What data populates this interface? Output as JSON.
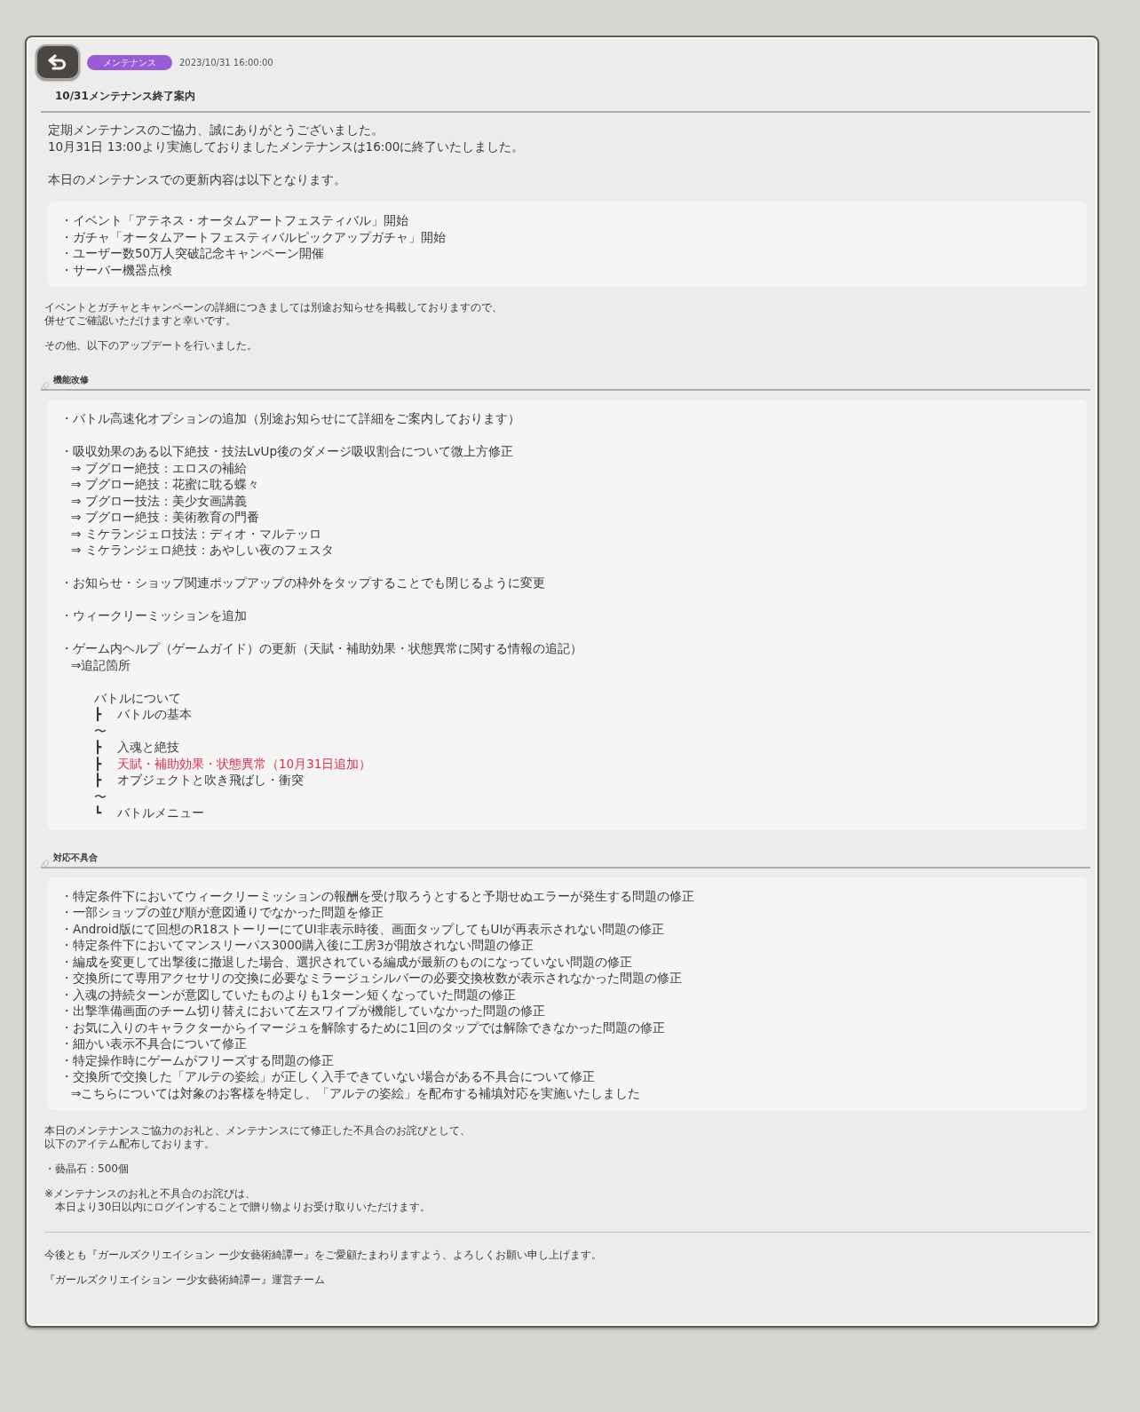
{
  "header": {
    "category": "メンテナンス",
    "date": "2023/10/31 16:00:00",
    "title": "10/31メンテナンス終了案内"
  },
  "blocks": [
    {
      "kind": "text",
      "paragraphs": [
        [
          "定期メンテナンスのご協力、誠にありがとうございました。",
          "10月31日 13:00より実施しておりましたメンテナンスは16:00に終了いたしました。"
        ],
        [
          "本日のメンテナンスでの更新内容は以下となります。"
        ]
      ]
    },
    {
      "kind": "box",
      "groups": [
        {
          "kind": "list",
          "items": [
            {
              "text": "・イベント「アテネス・オータムアートフェスティバル」開始"
            },
            {
              "text": "・ガチャ「オータムアートフェスティバルピックアップガチャ」開始"
            },
            {
              "text": "・ユーザー数50万人突破記念キャンペーン開催"
            },
            {
              "text": "・サーバー機器点検"
            }
          ]
        }
      ]
    },
    {
      "kind": "note",
      "paragraphs": [
        [
          "イベントとガチャとキャンペーンの詳細につきましては別途お知らせを掲載しておりますので、",
          "併せてご確認いただけますと幸いです。"
        ],
        [
          "その他、以下のアップデートを行いました。"
        ]
      ]
    },
    {
      "kind": "section",
      "title": "機能改修"
    },
    {
      "kind": "box",
      "groups": [
        {
          "kind": "list",
          "items": [
            {
              "text": "・バトル高速化オプションの追加（別途お知らせにて詳細をご案内しております）"
            }
          ]
        },
        {
          "kind": "list",
          "items": [
            {
              "text": "・吸収効果のある以下絶技・技法LvUp後のダメージ吸収割合について微上方修正",
              "children": [
                {
                  "text": "⇒ ブグロー絶技：エロスの補給"
                },
                {
                  "text": "⇒ ブグロー絶技：花蜜に耽る蝶々"
                },
                {
                  "text": "⇒ ブグロー技法：美少女画講義"
                },
                {
                  "text": "⇒ ブグロー絶技：美術教育の門番"
                },
                {
                  "text": "⇒ ミケランジェロ技法：ディオ・マルテッロ"
                },
                {
                  "text": "⇒ ミケランジェロ絶技：あやしい夜のフェスタ"
                }
              ]
            }
          ]
        },
        {
          "kind": "list",
          "items": [
            {
              "text": "・お知らせ・ショップ関連ポップアップの枠外をタップすることでも閉じるように変更"
            }
          ]
        },
        {
          "kind": "list",
          "items": [
            {
              "text": "・ウィークリーミッションを追加"
            }
          ]
        },
        {
          "kind": "list",
          "items": [
            {
              "text": "・ゲーム内ヘルプ（ゲームガイド）の更新（天賦・補助効果・状態異常に関する情報の追記）",
              "children": [
                {
                  "text": "⇒追記箇所"
                }
              ]
            }
          ]
        },
        {
          "kind": "tree",
          "title": "バトルについて",
          "rows": [
            {
              "mark": "┣",
              "text": "バトルの基本",
              "highlight": false
            },
            {
              "mark": "〜"
            },
            {
              "mark": "┣",
              "text": "入魂と絶技",
              "highlight": false
            },
            {
              "mark": "┣",
              "text": "天賦・補助効果・状態異常（10月31日追加）",
              "highlight": true
            },
            {
              "mark": "┣",
              "text": "オブジェクトと吹き飛ばし・衝突",
              "highlight": false
            },
            {
              "mark": "〜"
            },
            {
              "mark": "┗",
              "text": "バトルメニュー",
              "highlight": false
            }
          ]
        }
      ]
    },
    {
      "kind": "section",
      "title": "対応不具合"
    },
    {
      "kind": "box",
      "groups": [
        {
          "kind": "list",
          "items": [
            {
              "text": "・特定条件下においてウィークリーミッションの報酬を受け取ろうとすると予期せぬエラーが発生する問題の修正"
            },
            {
              "text": "・一部ショップの並び順が意図通りでなかった問題を修正"
            },
            {
              "text": "・Android版にて回想のR18ストーリーにてUI非表示時後、画面タップしてもUIが再表示されない問題の修正"
            },
            {
              "text": "・特定条件下においてマンスリーパス3000購入後に工房3が開放されない問題の修正"
            },
            {
              "text": "・編成を変更して出撃後に撤退した場合、選択されている編成が最新のものになっていない問題の修正"
            },
            {
              "text": "・交換所にて専用アクセサリの交換に必要なミラージュシルバーの必要交換枚数が表示されなかった問題の修正"
            },
            {
              "text": "・入魂の持続ターンが意図していたものよりも1ターン短くなっていた問題の修正"
            },
            {
              "text": "・出撃準備画面のチーム切り替えにおいて左スワイプが機能していなかった問題の修正"
            },
            {
              "text": "・お気に入りのキャラクターからイマージュを解除するために1回のタップでは解除できなかった問題の修正"
            },
            {
              "text": "・細かい表示不具合について修正"
            },
            {
              "text": "・特定操作時にゲームがフリーズする問題の修正"
            },
            {
              "text": "・交換所で交換した「アルテの姿絵」が正しく入手できていない場合がある不具合について修正",
              "children": [
                {
                  "text": "⇒こちらについては対象のお客様を特定し、「アルテの姿絵」を配布する補填対応を実施いたしました"
                }
              ]
            }
          ]
        }
      ]
    },
    {
      "kind": "note",
      "paragraphs": [
        [
          "本日のメンテナンスご協力のお礼と、メンテナンスにて修正した不具合のお詫びとして、",
          "以下のアイテム配布しております。"
        ],
        [
          "・藝晶石：500個"
        ],
        [
          "※メンテナンスのお礼と不具合のお詫びは、",
          "　本日より30日以内にログインすることで贈り物よりお受け取りいただけます。"
        ]
      ]
    },
    {
      "kind": "divider"
    },
    {
      "kind": "note",
      "paragraphs": [
        [
          "今後とも『ガールズクリエイション ー少女藝術綺譚ー』をご愛顧たまわりますよう、よろしくお願い申し上げます。"
        ],
        [
          "『ガールズクリエイション ー少女藝術綺譚ー』運営チーム"
        ]
      ]
    }
  ]
}
